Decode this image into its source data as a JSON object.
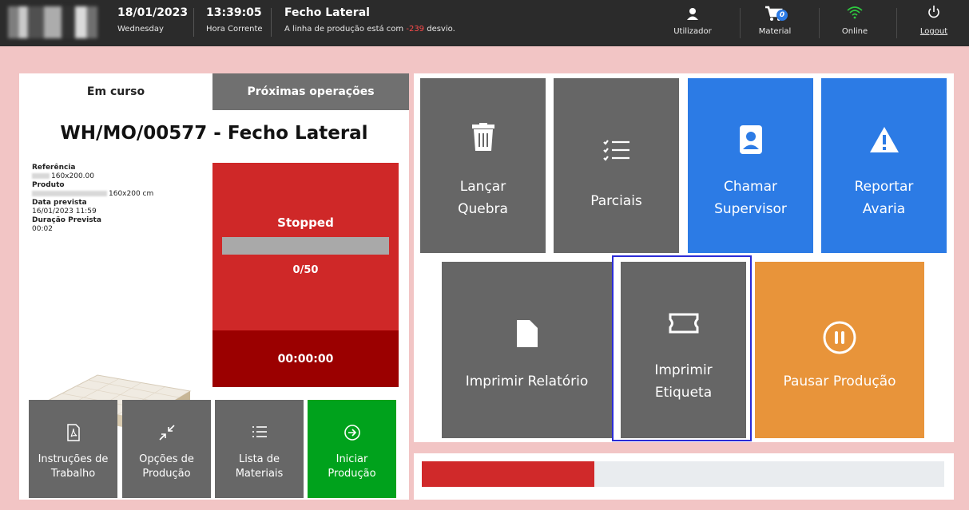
{
  "header": {
    "date": "18/01/2023",
    "weekday": "Wednesday",
    "time": "13:39:05",
    "time_label": "Hora Corrente",
    "workcenter": "Fecho Lateral",
    "deviation_prefix": "A linha de produção está com ",
    "deviation_value": "-239",
    "deviation_suffix": " desvio.",
    "user_label": "Utilizador",
    "material_label": "Material",
    "material_badge": "0",
    "online_label": "Online",
    "logout_label": "Logout"
  },
  "tabs": {
    "current": "Em curso",
    "next": "Próximas operações"
  },
  "order": {
    "title": "WH/MO/00577 - Fecho Lateral",
    "ref_label": "Referência",
    "ref_value": "160x200.00",
    "product_label": "Produto",
    "product_value": "160x200 cm",
    "date_label": "Data prevista",
    "date_value": "16/01/2023 11:59",
    "duration_label": "Duração Prevista",
    "duration_value": "00:02"
  },
  "status": {
    "state": "Stopped",
    "count": "0/50",
    "timer": "00:00:00"
  },
  "left_buttons": [
    {
      "label1": "Instruções de",
      "label2": "Trabalho"
    },
    {
      "label1": "Opções de",
      "label2": "Produção"
    },
    {
      "label1": "Lista de",
      "label2": "Materiais"
    },
    {
      "label1": "Iniciar",
      "label2": "Produção"
    }
  ],
  "tiles": {
    "quebra1": "Lançar",
    "quebra2": "Quebra",
    "parciais": "Parciais",
    "supervisor1": "Chamar",
    "supervisor2": "Supervisor",
    "avaria1": "Reportar",
    "avaria2": "Avaria",
    "relatorio": "Imprimir Relatório",
    "etiqueta1": "Imprimir",
    "etiqueta2": "Etiqueta",
    "pausar": "Pausar Produção"
  },
  "progress": {
    "fraction": 0.33
  },
  "colors": {
    "header": "#2b2b2b",
    "stopped_red": "#cf2828",
    "timer_red": "#9b0000",
    "start_green": "#00a21c",
    "blue": "#2c7be5",
    "orange": "#e8943a",
    "online_green": "#2ecc40"
  }
}
